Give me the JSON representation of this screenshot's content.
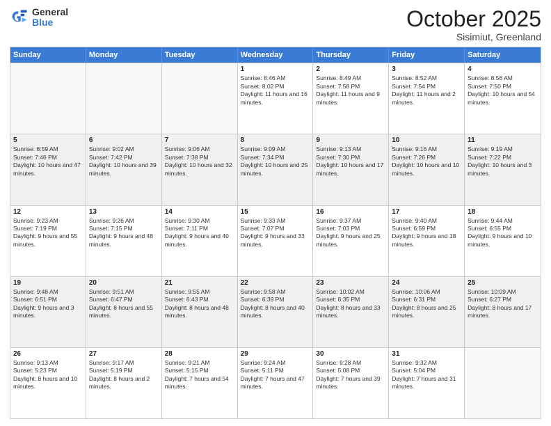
{
  "logo": {
    "general": "General",
    "blue": "Blue"
  },
  "header": {
    "month": "October 2025",
    "location": "Sisimiut, Greenland"
  },
  "days": [
    "Sunday",
    "Monday",
    "Tuesday",
    "Wednesday",
    "Thursday",
    "Friday",
    "Saturday"
  ],
  "weeks": [
    [
      {
        "day": "",
        "empty": true
      },
      {
        "day": "",
        "empty": true
      },
      {
        "day": "",
        "empty": true
      },
      {
        "day": "1",
        "sunrise": "Sunrise: 8:46 AM",
        "sunset": "Sunset: 8:02 PM",
        "daylight": "Daylight: 11 hours and 16 minutes."
      },
      {
        "day": "2",
        "sunrise": "Sunrise: 8:49 AM",
        "sunset": "Sunset: 7:58 PM",
        "daylight": "Daylight: 11 hours and 9 minutes."
      },
      {
        "day": "3",
        "sunrise": "Sunrise: 8:52 AM",
        "sunset": "Sunset: 7:54 PM",
        "daylight": "Daylight: 11 hours and 2 minutes."
      },
      {
        "day": "4",
        "sunrise": "Sunrise: 8:56 AM",
        "sunset": "Sunset: 7:50 PM",
        "daylight": "Daylight: 10 hours and 54 minutes."
      }
    ],
    [
      {
        "day": "5",
        "sunrise": "Sunrise: 8:59 AM",
        "sunset": "Sunset: 7:46 PM",
        "daylight": "Daylight: 10 hours and 47 minutes."
      },
      {
        "day": "6",
        "sunrise": "Sunrise: 9:02 AM",
        "sunset": "Sunset: 7:42 PM",
        "daylight": "Daylight: 10 hours and 39 minutes."
      },
      {
        "day": "7",
        "sunrise": "Sunrise: 9:06 AM",
        "sunset": "Sunset: 7:38 PM",
        "daylight": "Daylight: 10 hours and 32 minutes."
      },
      {
        "day": "8",
        "sunrise": "Sunrise: 9:09 AM",
        "sunset": "Sunset: 7:34 PM",
        "daylight": "Daylight: 10 hours and 25 minutes."
      },
      {
        "day": "9",
        "sunrise": "Sunrise: 9:13 AM",
        "sunset": "Sunset: 7:30 PM",
        "daylight": "Daylight: 10 hours and 17 minutes."
      },
      {
        "day": "10",
        "sunrise": "Sunrise: 9:16 AM",
        "sunset": "Sunset: 7:26 PM",
        "daylight": "Daylight: 10 hours and 10 minutes."
      },
      {
        "day": "11",
        "sunrise": "Sunrise: 9:19 AM",
        "sunset": "Sunset: 7:22 PM",
        "daylight": "Daylight: 10 hours and 3 minutes."
      }
    ],
    [
      {
        "day": "12",
        "sunrise": "Sunrise: 9:23 AM",
        "sunset": "Sunset: 7:19 PM",
        "daylight": "Daylight: 9 hours and 55 minutes."
      },
      {
        "day": "13",
        "sunrise": "Sunrise: 9:26 AM",
        "sunset": "Sunset: 7:15 PM",
        "daylight": "Daylight: 9 hours and 48 minutes."
      },
      {
        "day": "14",
        "sunrise": "Sunrise: 9:30 AM",
        "sunset": "Sunset: 7:11 PM",
        "daylight": "Daylight: 9 hours and 40 minutes."
      },
      {
        "day": "15",
        "sunrise": "Sunrise: 9:33 AM",
        "sunset": "Sunset: 7:07 PM",
        "daylight": "Daylight: 9 hours and 33 minutes."
      },
      {
        "day": "16",
        "sunrise": "Sunrise: 9:37 AM",
        "sunset": "Sunset: 7:03 PM",
        "daylight": "Daylight: 9 hours and 25 minutes."
      },
      {
        "day": "17",
        "sunrise": "Sunrise: 9:40 AM",
        "sunset": "Sunset: 6:59 PM",
        "daylight": "Daylight: 9 hours and 18 minutes."
      },
      {
        "day": "18",
        "sunrise": "Sunrise: 9:44 AM",
        "sunset": "Sunset: 6:55 PM",
        "daylight": "Daylight: 9 hours and 10 minutes."
      }
    ],
    [
      {
        "day": "19",
        "sunrise": "Sunrise: 9:48 AM",
        "sunset": "Sunset: 6:51 PM",
        "daylight": "Daylight: 9 hours and 3 minutes."
      },
      {
        "day": "20",
        "sunrise": "Sunrise: 9:51 AM",
        "sunset": "Sunset: 6:47 PM",
        "daylight": "Daylight: 8 hours and 55 minutes."
      },
      {
        "day": "21",
        "sunrise": "Sunrise: 9:55 AM",
        "sunset": "Sunset: 6:43 PM",
        "daylight": "Daylight: 8 hours and 48 minutes."
      },
      {
        "day": "22",
        "sunrise": "Sunrise: 9:58 AM",
        "sunset": "Sunset: 6:39 PM",
        "daylight": "Daylight: 8 hours and 40 minutes."
      },
      {
        "day": "23",
        "sunrise": "Sunrise: 10:02 AM",
        "sunset": "Sunset: 6:35 PM",
        "daylight": "Daylight: 8 hours and 33 minutes."
      },
      {
        "day": "24",
        "sunrise": "Sunrise: 10:06 AM",
        "sunset": "Sunset: 6:31 PM",
        "daylight": "Daylight: 8 hours and 25 minutes."
      },
      {
        "day": "25",
        "sunrise": "Sunrise: 10:09 AM",
        "sunset": "Sunset: 6:27 PM",
        "daylight": "Daylight: 8 hours and 17 minutes."
      }
    ],
    [
      {
        "day": "26",
        "sunrise": "Sunrise: 9:13 AM",
        "sunset": "Sunset: 5:23 PM",
        "daylight": "Daylight: 8 hours and 10 minutes."
      },
      {
        "day": "27",
        "sunrise": "Sunrise: 9:17 AM",
        "sunset": "Sunset: 5:19 PM",
        "daylight": "Daylight: 8 hours and 2 minutes."
      },
      {
        "day": "28",
        "sunrise": "Sunrise: 9:21 AM",
        "sunset": "Sunset: 5:15 PM",
        "daylight": "Daylight: 7 hours and 54 minutes."
      },
      {
        "day": "29",
        "sunrise": "Sunrise: 9:24 AM",
        "sunset": "Sunset: 5:11 PM",
        "daylight": "Daylight: 7 hours and 47 minutes."
      },
      {
        "day": "30",
        "sunrise": "Sunrise: 9:28 AM",
        "sunset": "Sunset: 5:08 PM",
        "daylight": "Daylight: 7 hours and 39 minutes."
      },
      {
        "day": "31",
        "sunrise": "Sunrise: 9:32 AM",
        "sunset": "Sunset: 5:04 PM",
        "daylight": "Daylight: 7 hours and 31 minutes."
      },
      {
        "day": "",
        "empty": true
      }
    ]
  ]
}
